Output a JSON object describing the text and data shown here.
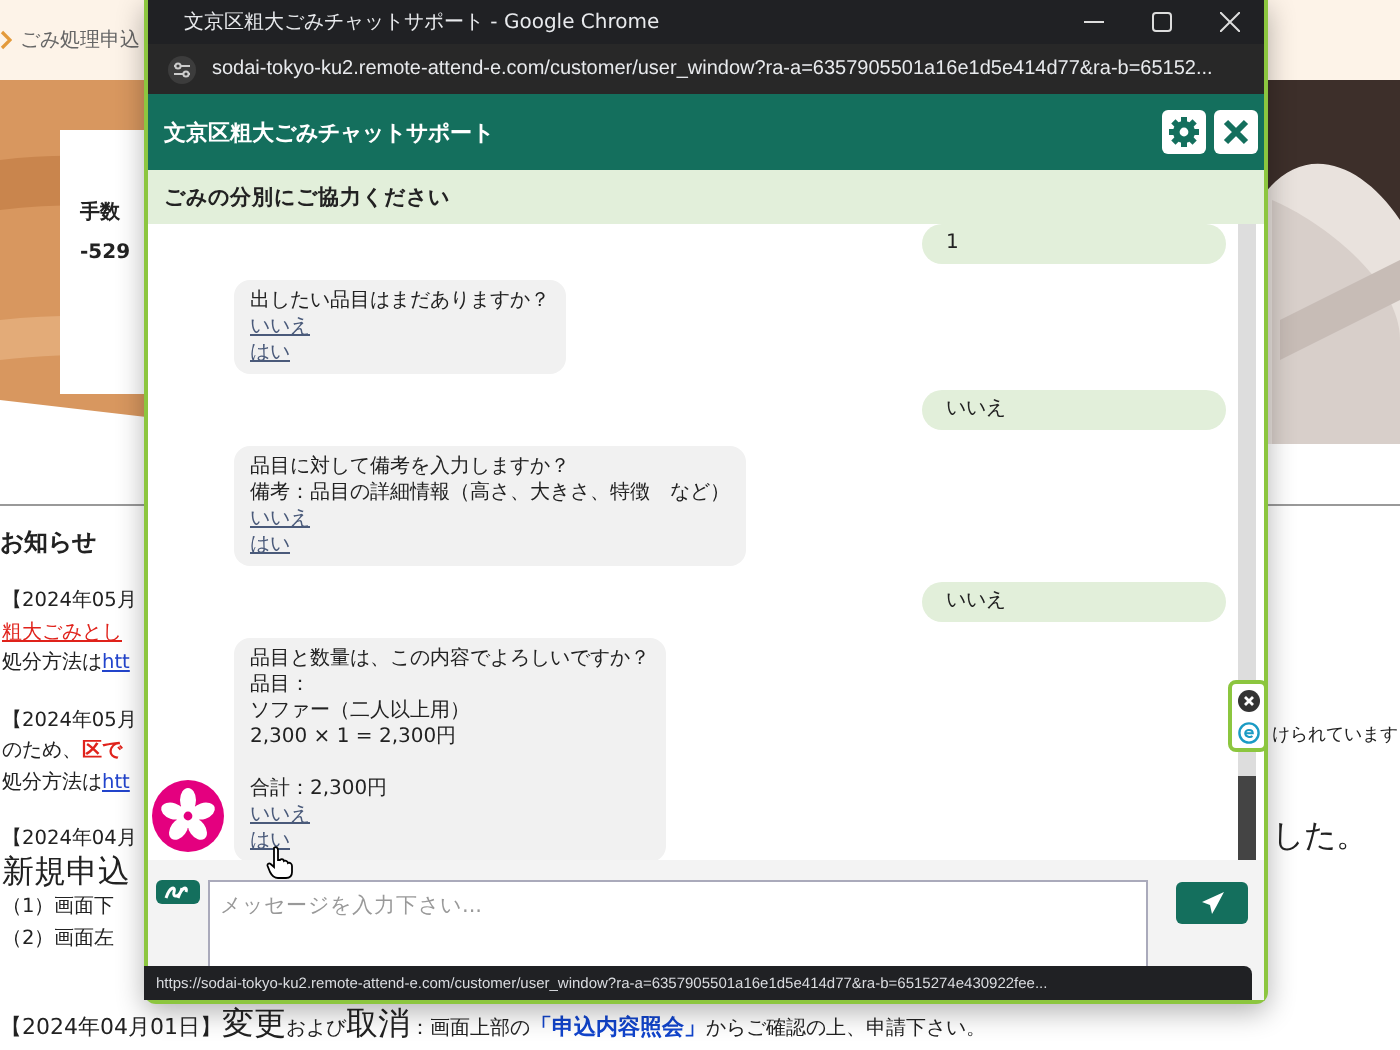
{
  "background": {
    "breadcrumb": "ごみ処理申込",
    "card_lines": [
      "手数",
      "-529"
    ],
    "notices_title": "お知らせ",
    "notices": [
      {
        "lines": [
          [
            {
              "text": "【2024年05月",
              "kind": "plain"
            }
          ],
          [
            {
              "text": "粗大ごみとし",
              "kind": "red-link"
            }
          ],
          [
            {
              "text": "処分方法は",
              "kind": "plain"
            },
            {
              "text": "htt",
              "kind": "link"
            }
          ]
        ]
      },
      {
        "lines": [
          [
            {
              "text": "【2024年05月",
              "kind": "plain"
            }
          ],
          [
            {
              "text": "のため、",
              "kind": "plain"
            },
            {
              "text": "区で",
              "kind": "red-bold"
            }
          ],
          [
            {
              "text": "処分方法は",
              "kind": "plain"
            },
            {
              "text": "htt",
              "kind": "link"
            }
          ]
        ]
      },
      {
        "lines": [
          [
            {
              "text": "【2024年04月",
              "kind": "plain"
            }
          ],
          [
            {
              "text": "新規申込",
              "kind": "large"
            }
          ],
          [
            {
              "text": "（1）画面下",
              "kind": "plain"
            }
          ],
          [
            {
              "text": "（2）画面左",
              "kind": "plain"
            }
          ]
        ]
      }
    ],
    "right_lines": [
      {
        "text": "けられています",
        "kind": "plain"
      },
      {
        "text": "した。",
        "kind": "large"
      }
    ],
    "footer": [
      {
        "text": "【2024年04月01日】",
        "kind": "plain"
      },
      {
        "text": "変更",
        "kind": "large"
      },
      {
        "text": "および",
        "kind": "small"
      },
      {
        "text": "取消",
        "kind": "large"
      },
      {
        "text": "：画面上部の",
        "kind": "small"
      },
      {
        "text": "「申込内容照会」",
        "kind": "blue-bold"
      },
      {
        "text": "からご確認の上、申請下さい。",
        "kind": "small"
      }
    ]
  },
  "browser": {
    "title": "文京区粗大ごみチャットサポート - Google Chrome",
    "url": "sodai-tokyo-ku2.remote-attend-e.com/customer/user_window?ra-a=6357905501a16e1d5e414d77&ra-b=65152...",
    "status_url": "https://sodai-tokyo-ku2.remote-attend-e.com/customer/user_window?ra-a=6357905501a16e1d5e414d77&ra-b=6515274e430922fee..."
  },
  "chat": {
    "title": "文京区粗大ごみチャットサポート",
    "subtitle": "ごみの分別にご協力ください",
    "messages": [
      {
        "kind": "user",
        "text": "1"
      },
      {
        "kind": "bot",
        "avatar": false,
        "paragraphs": [
          [
            "出したい品目はまだありますか？"
          ]
        ],
        "options": [
          "いいえ",
          "はい"
        ]
      },
      {
        "kind": "user",
        "text": "いいえ"
      },
      {
        "kind": "bot",
        "avatar": false,
        "paragraphs": [
          [
            "品目に対して備考を入力しますか？",
            "備考：品目の詳細情報（高さ、大きさ、特徴　など）"
          ]
        ],
        "options": [
          "いいえ",
          "はい"
        ]
      },
      {
        "kind": "user",
        "text": "いいえ"
      },
      {
        "kind": "bot",
        "avatar": true,
        "paragraphs": [
          [
            "品目と数量は、この内容でよろしいですか？",
            "品目：",
            "ソファー（二人以上用）",
            "2,300 × 1 = 2,300円"
          ],
          [
            "合計：2,300円"
          ]
        ],
        "options": [
          "いいえ",
          "はい"
        ]
      }
    ],
    "input": {
      "placeholder": "メッセージを入力下さい..."
    }
  }
}
